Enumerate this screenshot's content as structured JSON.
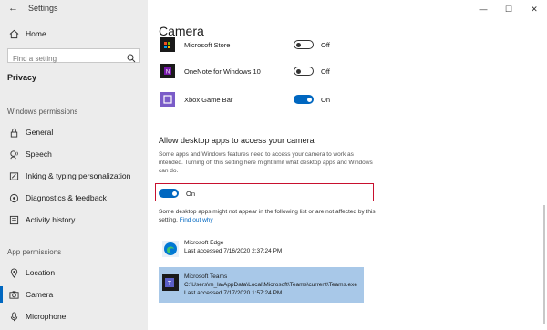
{
  "window": {
    "app_title": "Settings",
    "minimize": "—",
    "maximize": "☐",
    "close": "✕"
  },
  "sidebar": {
    "home_label": "Home",
    "search_placeholder": "Find a setting",
    "section_title": "Privacy",
    "group_windows": "Windows permissions",
    "windows_items": [
      {
        "label": "General",
        "icon": "lock-icon"
      },
      {
        "label": "Speech",
        "icon": "microphone-speech-icon"
      },
      {
        "label": "Inking & typing personalization",
        "icon": "inking-icon"
      },
      {
        "label": "Diagnostics & feedback",
        "icon": "diagnostics-icon"
      },
      {
        "label": "Activity history",
        "icon": "activity-icon"
      }
    ],
    "group_app": "App permissions",
    "app_items": [
      {
        "label": "Location",
        "icon": "location-icon"
      },
      {
        "label": "Camera",
        "icon": "camera-icon",
        "selected": true
      },
      {
        "label": "Microphone",
        "icon": "microphone-icon"
      }
    ]
  },
  "main": {
    "page_title": "Camera",
    "apps": [
      {
        "name": "Microsoft Store",
        "state": "Off",
        "on": false
      },
      {
        "name": "OneNote for Windows 10",
        "state": "Off",
        "on": false
      },
      {
        "name": "Xbox Game Bar",
        "state": "On",
        "on": true
      }
    ],
    "desktop_section": {
      "heading": "Allow desktop apps to access your camera",
      "description": "Some apps and Windows features need to access your camera to work as intended. Turning off this setting here might limit what desktop apps and Windows can do.",
      "toggle_label": "On",
      "toggle_on": true,
      "note": "Some desktop apps might not appear in the following list or are not affected by this setting.",
      "note_link": "Find out why"
    },
    "desktop_apps": [
      {
        "name": "Microsoft Edge",
        "path": "",
        "last_accessed": "Last accessed 7/16/2020 2:37:24 PM",
        "selected": false
      },
      {
        "name": "Microsoft Teams",
        "path": "C:\\Users\\m_la\\AppData\\Local\\Microsoft\\Teams\\current\\Teams.exe",
        "last_accessed": "Last accessed 7/17/2020 1:57:24 PM",
        "selected": true
      }
    ]
  },
  "colors": {
    "accent": "#0067c0",
    "highlight_border": "#c8102e",
    "selected_bg": "#a8c8e8",
    "sidebar_bg": "#ececec"
  }
}
